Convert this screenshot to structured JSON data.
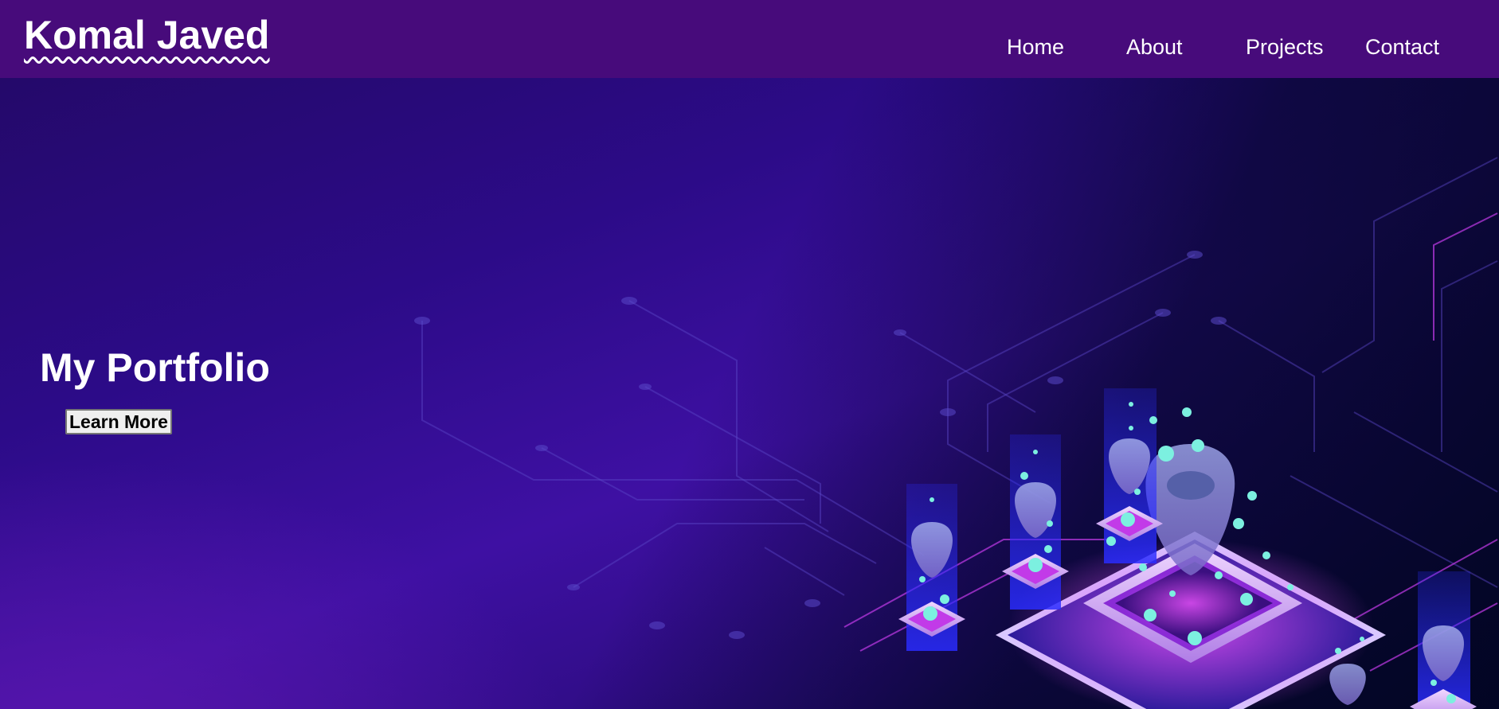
{
  "navbar": {
    "brand": "Komal Javed",
    "links": [
      {
        "label": "Home"
      },
      {
        "label": "About"
      },
      {
        "label": "Projects"
      },
      {
        "label": "Contact"
      }
    ]
  },
  "hero": {
    "title": "My Portfolio",
    "button_label": "Learn More",
    "illustration": "isometric-circuit-board-illustration"
  },
  "colors": {
    "navbar_bg": "#470b7b",
    "hero_bg": "#3e10a3",
    "accent_cyan": "#7cf0e0",
    "accent_magenta": "#c23ae8"
  }
}
